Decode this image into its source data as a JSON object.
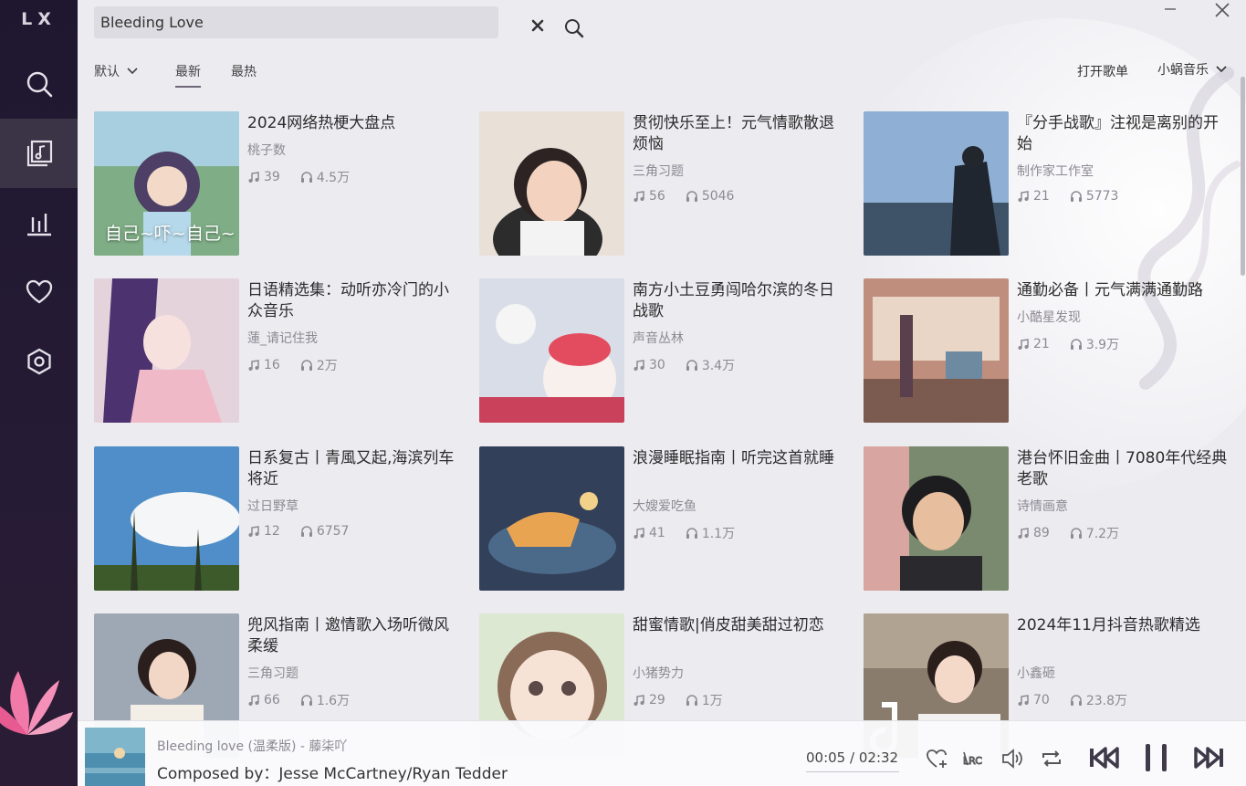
{
  "app": {
    "logo": "LX"
  },
  "sidebar": {
    "items": [
      {
        "id": "search",
        "icon": "search-icon"
      },
      {
        "id": "songlist",
        "icon": "music-list-icon",
        "active": true
      },
      {
        "id": "leaderboard",
        "icon": "bar-chart-icon"
      },
      {
        "id": "favorites",
        "icon": "heart-icon"
      },
      {
        "id": "settings",
        "icon": "settings-hexagon-icon"
      }
    ]
  },
  "search": {
    "value": "Bleeding Love"
  },
  "filters": {
    "sort_label": "默认",
    "tabs": [
      {
        "label": "最新",
        "active": true
      },
      {
        "label": "最热",
        "active": false
      }
    ],
    "open_list_label": "打开歌单",
    "source_label": "小蜗音乐"
  },
  "playlists": [
    {
      "title": "2024网络热梗大盘点",
      "author": "桃子数",
      "songs": "39",
      "plays": "4.5万",
      "cover_text": "自己~吓~自己~"
    },
    {
      "title": "贯彻快乐至上！元气情歌散退烦恼",
      "author": "三角习题",
      "songs": "56",
      "plays": "5046"
    },
    {
      "title": "『分手战歌』注视是离别的开始",
      "author": "制作家工作室",
      "songs": "21",
      "plays": "5773"
    },
    {
      "title": "日语精选集：动听亦冷门的小众音乐",
      "author": "蓮_请记住我",
      "songs": "16",
      "plays": "2万"
    },
    {
      "title": "南方小土豆勇闯哈尔滨的冬日战歌",
      "author": "声音丛林",
      "songs": "30",
      "plays": "3.4万"
    },
    {
      "title": "通勤必备丨元气满满通勤路",
      "author": "小酷星发现",
      "songs": "21",
      "plays": "3.9万"
    },
    {
      "title": "日系复古丨青風又起,海滨列车将近",
      "author": "过日野草",
      "songs": "12",
      "plays": "6757"
    },
    {
      "title": "浪漫睡眠指南丨听完这首就睡",
      "author": "大嫂爱吃鱼",
      "songs": "41",
      "plays": "1.1万"
    },
    {
      "title": "港台怀旧金曲丨7080年代经典老歌",
      "author": "诗情画意",
      "songs": "89",
      "plays": "7.2万"
    },
    {
      "title": "兜风指南丨邀情歌入场听微风柔缓",
      "author": "三角习题",
      "songs": "66",
      "plays": "1.6万"
    },
    {
      "title": "甜蜜情歌|俏皮甜美甜过初恋",
      "author": "小猪势力",
      "songs": "29",
      "plays": "1万"
    },
    {
      "title": "2024年11月抖音热歌精选",
      "author": "小鑫砸",
      "songs": "70",
      "plays": "23.8万"
    }
  ],
  "player": {
    "song": "Bleeding love (温柔版) - 藤柒吖",
    "lyric": "Composed by：Jesse McCartney/Ryan Tedder",
    "current_time": "00:05",
    "separator": "/",
    "total_time": "02:32"
  }
}
